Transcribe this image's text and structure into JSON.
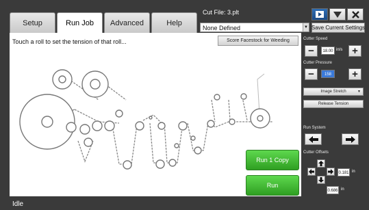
{
  "tabs": [
    {
      "label": "Setup",
      "active": false
    },
    {
      "label": "Run Job",
      "active": true
    },
    {
      "label": "Advanced",
      "active": false
    },
    {
      "label": "Help",
      "active": false
    }
  ],
  "header": {
    "cut_file": "Cut File: 3.plt",
    "file_select_value": "None Defined",
    "save_settings_label": "Save Current Settings"
  },
  "main": {
    "instruction": "Touch a roll to set the tension of that roll...",
    "score_label": "Score Facestock for Weeding",
    "run_one_label": "Run 1 Copy",
    "run_label": "Run"
  },
  "side": {
    "cutter_speed_label": "Cutter Speed",
    "cutter_speed_value": "18.00",
    "cutter_speed_unit": "in/s",
    "cutter_pressure_label": "Cutter Pressure",
    "cutter_pressure_value": "158",
    "image_stretch_label": "Image Stretch",
    "release_tension_label": "Release Tension",
    "run_system_label": "Run System",
    "cutter_offsets_label": "Cutter Offsets",
    "offset_x_value": "0.181",
    "offset_y_value": "0.686",
    "offset_unit": "in"
  },
  "status": {
    "text": "Idle"
  },
  "colors": {
    "background": "#3a3a3a",
    "accent_green": "#3fb832",
    "selection_blue": "#3b7ad9"
  }
}
